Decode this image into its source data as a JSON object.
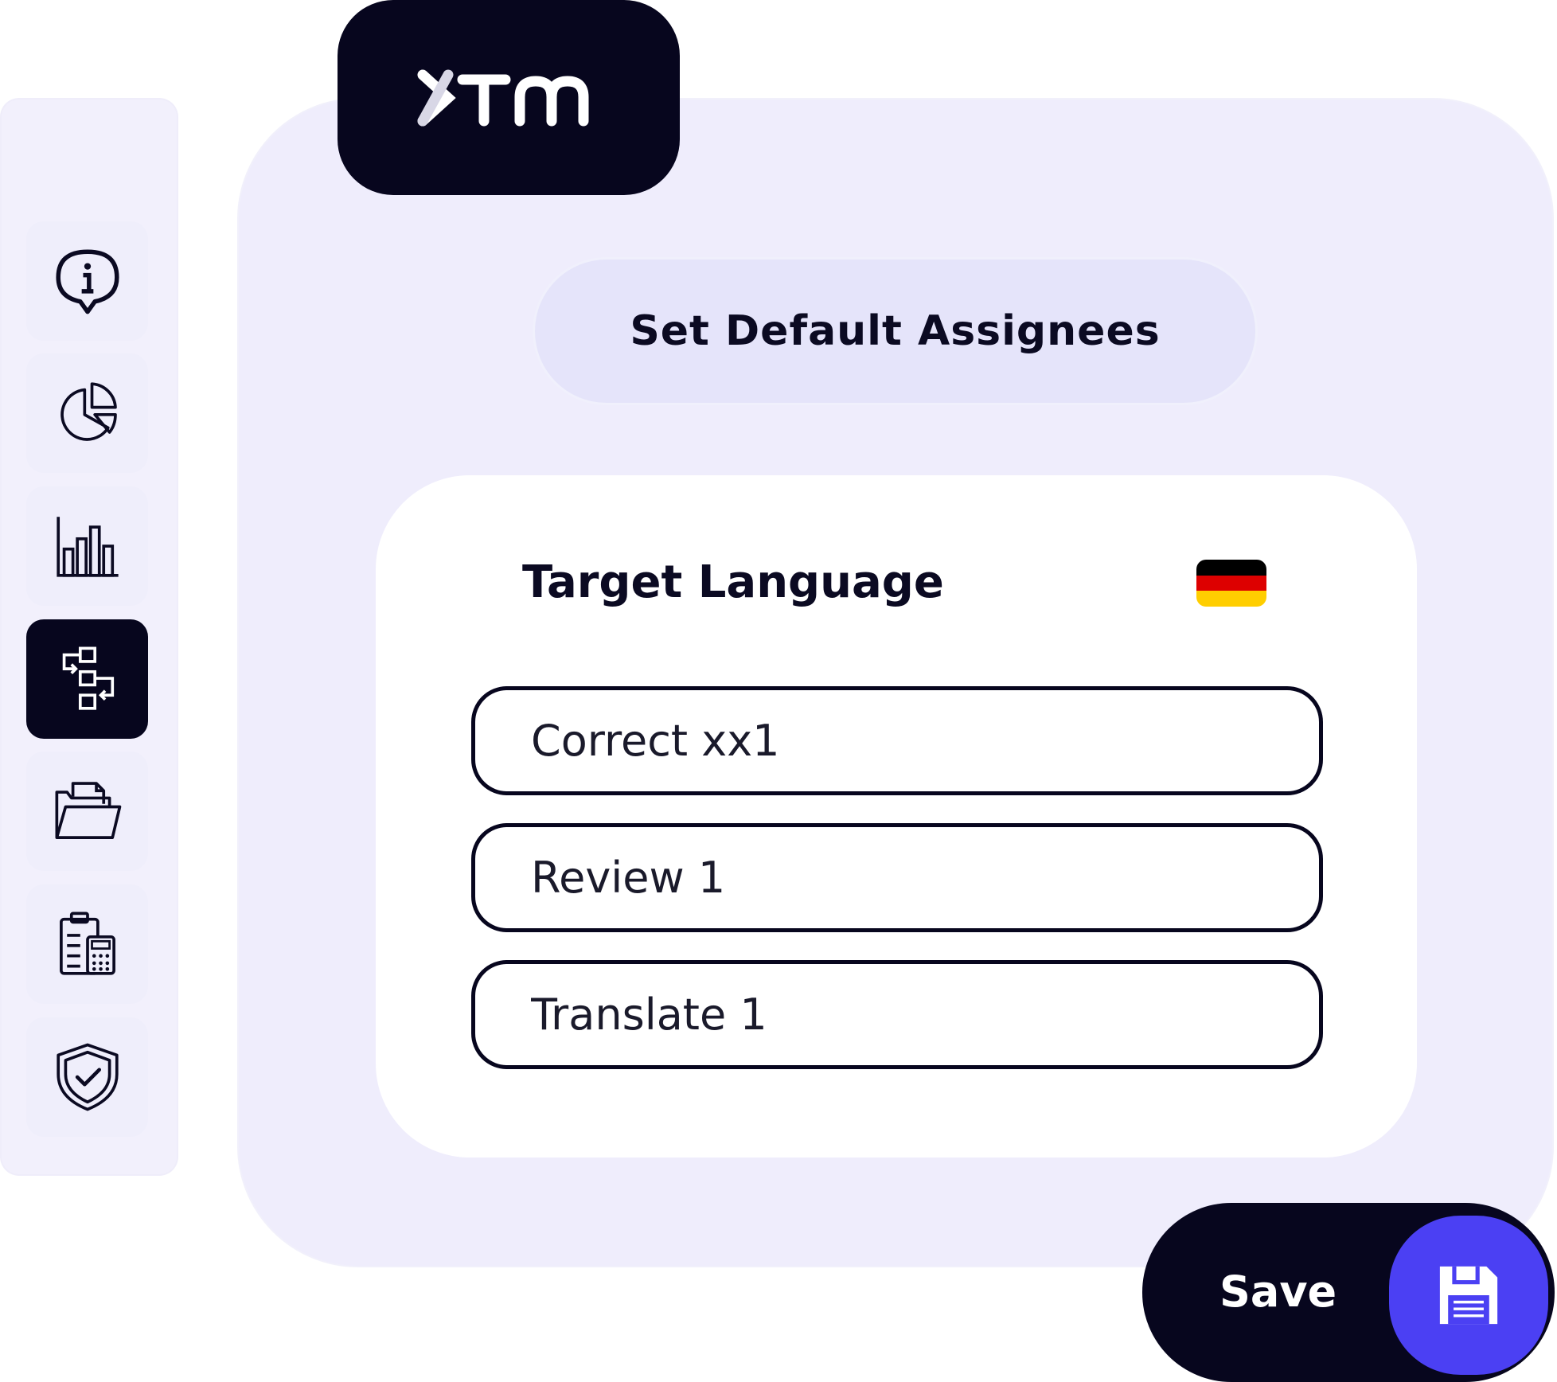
{
  "sidebar": {
    "logo_text": "XTM",
    "items": [
      {
        "icon": "info-bubble-icon",
        "active": false
      },
      {
        "icon": "pie-chart-icon",
        "active": false
      },
      {
        "icon": "bar-chart-icon",
        "active": false
      },
      {
        "icon": "workflow-icon",
        "active": true
      },
      {
        "icon": "folder-icon",
        "active": false
      },
      {
        "icon": "clipboard-calculator-icon",
        "active": false
      },
      {
        "icon": "shield-check-icon",
        "active": false
      }
    ]
  },
  "brand": {
    "logo_text": "XTM"
  },
  "header": {
    "title": "Set Default Assignees"
  },
  "form": {
    "target_language_label": "Target Language",
    "flag": {
      "name": "germany-flag-icon",
      "colors": [
        "#000000",
        "#dd0000",
        "#ffce00"
      ]
    },
    "fields": [
      {
        "name": "correct-assignee-field",
        "value": "Correct xx1"
      },
      {
        "name": "review-assignee-field",
        "value": "Review 1"
      },
      {
        "name": "translate-assignee-field",
        "value": "Translate 1"
      }
    ]
  },
  "actions": {
    "save_label": "Save",
    "save_icon": "floppy-disk-icon"
  },
  "colors": {
    "dark": "#07061e",
    "accent": "#4b40f3",
    "panel": "#efedfc",
    "pill": "#e5e4fa"
  }
}
